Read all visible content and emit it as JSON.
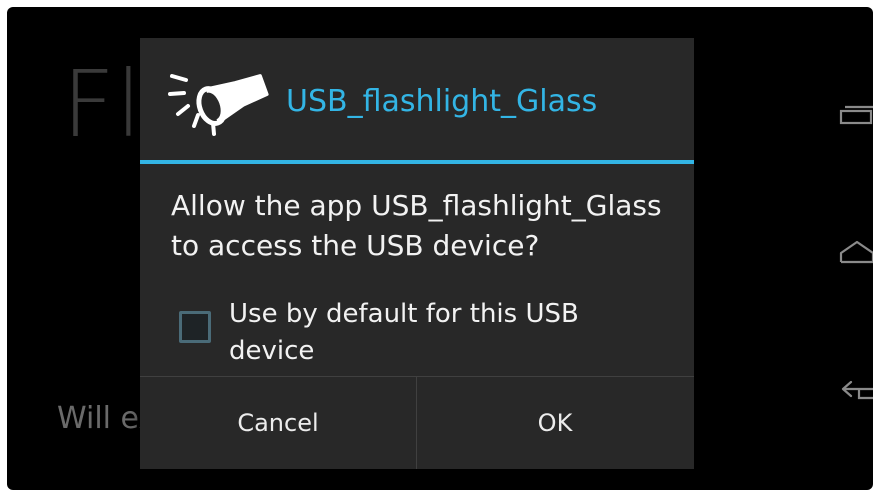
{
  "background_app": {
    "title_fragment": "Fla",
    "subtitle_fragment": "Will ex"
  },
  "dialog": {
    "title": "USB_flashlight_Glass",
    "icon": "flashlight-icon",
    "message": "Allow the app USB_flashlight_Glass to access the USB device?",
    "checkbox_label": "Use by default for this USB device",
    "checkbox_checked": false,
    "cancel_label": "Cancel",
    "ok_label": "OK"
  },
  "navigation_bar": {
    "recent_icon": "recent-apps-icon",
    "home_icon": "home-icon",
    "back_icon": "back-icon"
  },
  "colors": {
    "accent": "#33b5e5",
    "dialog_background": "#282828",
    "screen_background": "#000000"
  }
}
